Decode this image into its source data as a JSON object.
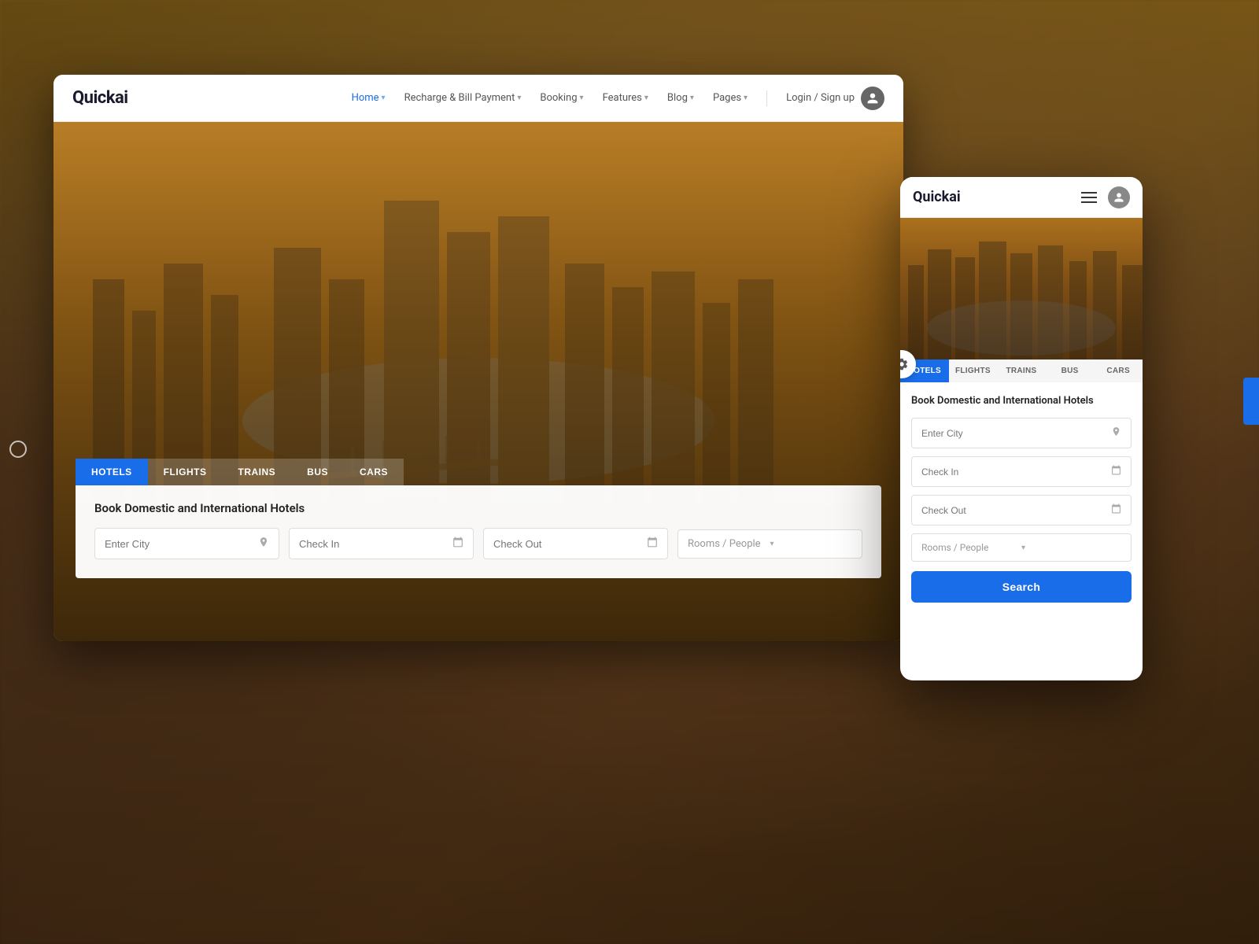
{
  "background": {
    "color": "#3a2a1e"
  },
  "desktop": {
    "logo": "Quickai",
    "nav": {
      "links": [
        {
          "label": "Home",
          "active": true,
          "hasChevron": true
        },
        {
          "label": "Recharge & Bill Payment",
          "active": false,
          "hasChevron": true
        },
        {
          "label": "Booking",
          "active": false,
          "hasChevron": true
        },
        {
          "label": "Features",
          "active": false,
          "hasChevron": true
        },
        {
          "label": "Blog",
          "active": false,
          "hasChevron": true
        },
        {
          "label": "Pages",
          "active": false,
          "hasChevron": true
        }
      ],
      "login_label": "Login / Sign up"
    },
    "booking": {
      "tabs": [
        {
          "label": "HOTELS",
          "active": true
        },
        {
          "label": "FLIGHTS",
          "active": false
        },
        {
          "label": "TRAINS",
          "active": false
        },
        {
          "label": "BUS",
          "active": false
        },
        {
          "label": "CARS",
          "active": false
        }
      ],
      "title": "Book Domestic and International Hotels",
      "fields": {
        "city_placeholder": "Enter City",
        "checkin_placeholder": "Check In",
        "checkout_placeholder": "Check Out",
        "rooms_placeholder": "Rooms / People"
      }
    }
  },
  "mobile": {
    "logo": "Quickai",
    "booking": {
      "tabs": [
        {
          "label": "HOTELS",
          "active": true
        },
        {
          "label": "FLIGHTS",
          "active": false
        },
        {
          "label": "TRAINS",
          "active": false
        },
        {
          "label": "BUS",
          "active": false
        },
        {
          "label": "CARS",
          "active": false
        }
      ],
      "title": "Book Domestic and International Hotels",
      "fields": {
        "city_placeholder": "Enter City",
        "checkin_placeholder": "Check In",
        "checkout_placeholder": "Check Out",
        "rooms_placeholder": "Rooms / People"
      },
      "search_label": "Search"
    }
  },
  "icons": {
    "location": "📍",
    "calendar": "📅",
    "chevron_down": "▾",
    "user": "👤",
    "gear": "⚙",
    "hamburger": "≡"
  }
}
